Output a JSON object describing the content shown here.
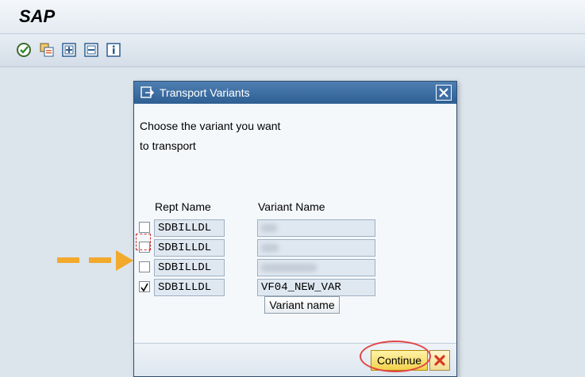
{
  "app": {
    "title": "SAP"
  },
  "toolbar": {
    "buttons": [
      {
        "icon": "execute-icon"
      },
      {
        "icon": "copy-objects-icon"
      },
      {
        "icon": "select-all-icon"
      },
      {
        "icon": "deselect-all-icon"
      },
      {
        "icon": "info-icon"
      }
    ]
  },
  "dialog": {
    "title": "Transport Variants",
    "prompt_line1": "Choose the variant you want",
    "prompt_line2": "to transport",
    "col_rept": "Rept Name",
    "col_variant": "Variant Name",
    "rows": [
      {
        "checked": false,
        "rept": "SDBILLDL",
        "variant": "",
        "obscured": true
      },
      {
        "checked": false,
        "rept": "SDBILLDL",
        "variant": "",
        "obscured": true
      },
      {
        "checked": false,
        "rept": "SDBILLDL",
        "variant": "",
        "obscured": true
      },
      {
        "checked": true,
        "rept": "SDBILLDL",
        "variant": "VF04_NEW_VAR",
        "obscured": false
      }
    ],
    "variant_name_button": "Variant name",
    "continue_button": "Continue"
  },
  "colors": {
    "accent_arrow": "#f2a92c",
    "highlight": "#e14545",
    "title_bar": "#3b6c9f"
  }
}
